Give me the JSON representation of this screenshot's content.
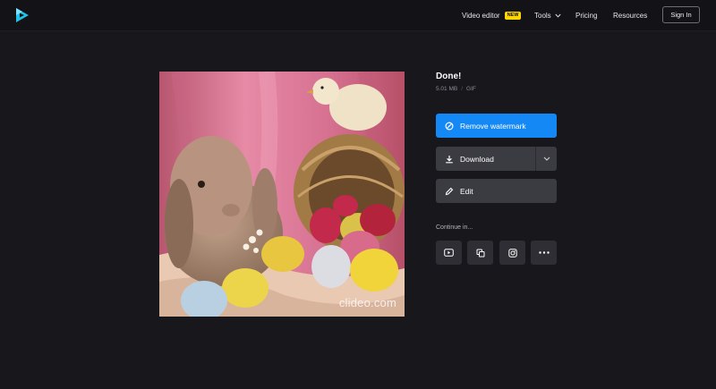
{
  "header": {
    "logo": "clideo-play-logo",
    "nav": {
      "video_editor": "Video editor",
      "new_badge": "NEW",
      "tools": "Tools",
      "pricing": "Pricing",
      "resources": "Resources"
    },
    "sign_in": "Sign In"
  },
  "preview": {
    "watermark": "clideo.com"
  },
  "result": {
    "title": "Done!",
    "size": "5.01 MB",
    "separator": "/",
    "format": "GIF"
  },
  "actions": {
    "remove_watermark": "Remove watermark",
    "download": "Download",
    "edit": "Edit"
  },
  "continue": {
    "label": "Continue in...",
    "icons": [
      "youtube-icon",
      "copy-icon",
      "instagram-icon",
      "more-icon"
    ]
  },
  "colors": {
    "background": "#17171c",
    "accent": "#1488f5",
    "button": "#3b3b42",
    "badge": "#ffd600"
  }
}
